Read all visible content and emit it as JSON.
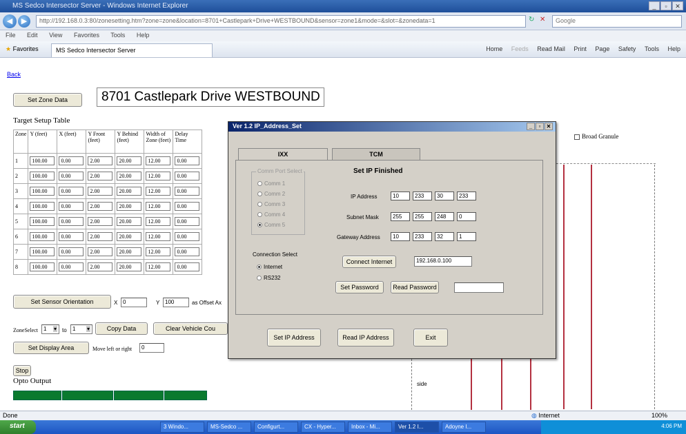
{
  "window": {
    "title": "MS Sedco Intersector Server - Windows Internet Explorer",
    "controls": [
      "_",
      "▫",
      "✕"
    ]
  },
  "nav": {
    "address": "http://192.168.0.3:80/zonesetting.htm?zone=zone&location=8701+Castlepark+Drive+WESTBOUND&sensor=zone1&mode=&slot=&zonedata=1",
    "search_placeholder": "Google"
  },
  "menu": [
    "File",
    "Edit",
    "View",
    "Favorites",
    "Tools",
    "Help"
  ],
  "favorites": {
    "label": "Favorites",
    "tab": "MS Sedco Intersector Server",
    "commands": [
      "Home",
      "Feeds",
      "Read Mail",
      "Print",
      "Page",
      "Safety",
      "Tools",
      "Help"
    ]
  },
  "page": {
    "back_link": "Back",
    "set_zone_data": "Set Zone Data",
    "location": "8701 Castlepark Drive WESTBOUND",
    "table_title": "Target Setup Table",
    "headers": [
      "Zone",
      "Y (feet)",
      "X (feet)",
      "Y Front (feet)",
      "Y Behind (feet)",
      "Width of Zone (feet)",
      "Delay Time"
    ],
    "rows": [
      [
        "1",
        "100.00",
        "0.00",
        "2.00",
        "20.00",
        "12.00",
        "0.00"
      ],
      [
        "2",
        "100.00",
        "0.00",
        "2.00",
        "20.00",
        "12.00",
        "0.00"
      ],
      [
        "3",
        "100.00",
        "0.00",
        "2.00",
        "20.00",
        "12.00",
        "0.00"
      ],
      [
        "4",
        "100.00",
        "0.00",
        "2.00",
        "20.00",
        "12.00",
        "0.00"
      ],
      [
        "5",
        "100.00",
        "0.00",
        "2.00",
        "20.00",
        "12.00",
        "0.00"
      ],
      [
        "6",
        "100.00",
        "0.00",
        "2.00",
        "20.00",
        "12.00",
        "0.00"
      ],
      [
        "7",
        "100.00",
        "0.00",
        "2.00",
        "20.00",
        "12.00",
        "0.00"
      ],
      [
        "8",
        "100.00",
        "0.00",
        "2.00",
        "20.00",
        "12.00",
        "0.00"
      ]
    ],
    "sensor_orientation_btn": "Set Sensor Orientation",
    "x_label": "X",
    "x_value": "0",
    "y_label": "Y",
    "y_value": "100",
    "offset_label": "as Offset Ax",
    "zone_select_label": "ZoneSelect",
    "zone_select_value": "1",
    "to_label": "to",
    "to_value": "1",
    "copy_data": "Copy Data",
    "clear_vehicle": "Clear Vehicle Cou",
    "set_display_area": "Set Display Area",
    "move_label": "Move left or right",
    "move_value": "0",
    "stop": "Stop",
    "opto_output": "Opto Output",
    "broad_granule": "Broad Granule",
    "right_label": "side"
  },
  "dialog": {
    "title": "Ver 1.2 IP_Address_Set",
    "tabs": [
      "IXX",
      "TCM"
    ],
    "status": "Set IP Finished",
    "comm_group": "Comm Port Select",
    "comm_ports": [
      "Comm 1",
      "Comm 2",
      "Comm 3",
      "Comm 4",
      "Comm 5"
    ],
    "ip_label": "IP Address",
    "ip": [
      "10",
      "233",
      "30",
      "233"
    ],
    "subnet_label": "Subnet Mask",
    "subnet": [
      "255",
      "255",
      "248",
      "0"
    ],
    "gateway_label": "Gateway Address",
    "gateway": [
      "10",
      "233",
      "32",
      "1"
    ],
    "connection_label": "Connection Select",
    "connection_options": [
      "Internet",
      "RS232"
    ],
    "connect_internet": "Connect Internet",
    "connect_ip": "192.168.0.100",
    "set_password": "Set Password",
    "read_password": "Read Password",
    "password_value": "",
    "set_ip": "Set IP Address",
    "read_ip": "Read IP Address",
    "exit": "Exit"
  },
  "status": {
    "left": "Done",
    "zone": "Internet",
    "zoom": "100%"
  },
  "taskbar": {
    "start": "start",
    "tasks": [
      "3 Windo...",
      "MS-Sedco ...",
      "Configurt...",
      "CX - Hyper...",
      "Inbox - Mi...",
      "Ver 1.2 I...",
      "Adoyne I..."
    ],
    "clock": "4:06 PM"
  }
}
